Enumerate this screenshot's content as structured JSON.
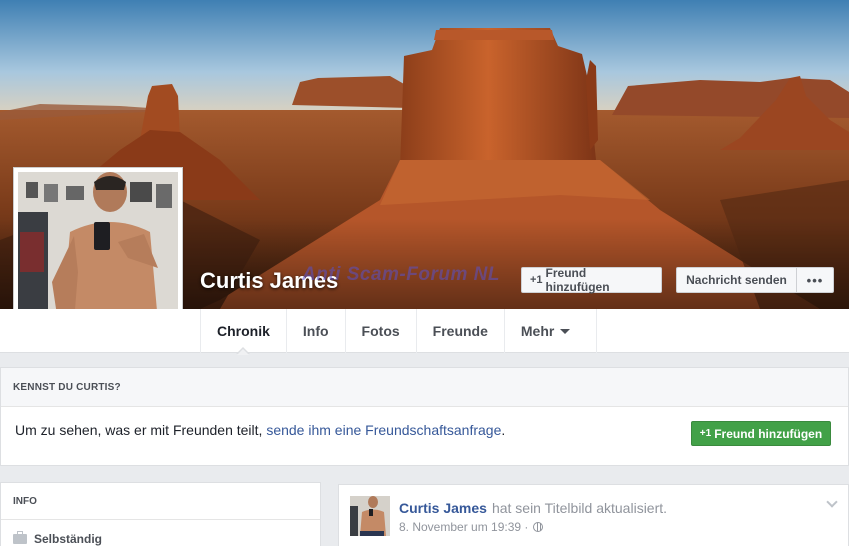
{
  "profile": {
    "name": "Curtis James",
    "watermark": "Anti Scam-Forum NL"
  },
  "cover_buttons": {
    "add_friend": "Freund hinzufügen",
    "send_message": "Nachricht senden",
    "more": "•••"
  },
  "tabs": [
    {
      "label": "Chronik",
      "active": true
    },
    {
      "label": "Info",
      "active": false
    },
    {
      "label": "Fotos",
      "active": false
    },
    {
      "label": "Freunde",
      "active": false
    },
    {
      "label": "Mehr",
      "active": false
    }
  ],
  "know_box": {
    "heading": "KENNST DU CURTIS?",
    "text_before": "Um zu sehen, was er mit Freunden teilt, ",
    "link": "sende ihm eine Freundschaftsanfrage",
    "text_after": ".",
    "button": "Freund hinzufügen",
    "button_color": "#42a148"
  },
  "info_card": {
    "heading": "INFO",
    "items": [
      {
        "icon": "briefcase-icon",
        "label": "Selbständig"
      }
    ]
  },
  "post": {
    "author": "Curtis James",
    "action": "hat sein Titelbild aktualisiert.",
    "timestamp": "8. November um 19:39 ·",
    "privacy_icon": "globe-icon"
  },
  "colors": {
    "link": "#365899",
    "background": "#e9ebee"
  }
}
